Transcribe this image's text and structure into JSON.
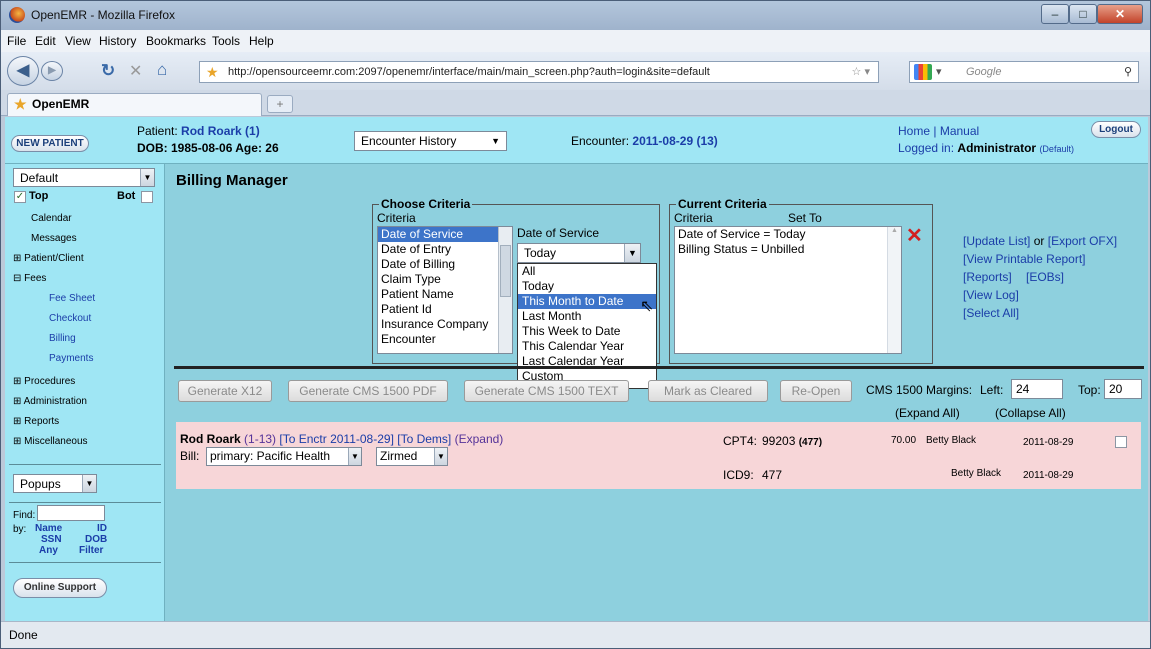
{
  "window": {
    "title": "OpenEMR - Mozilla Firefox",
    "min": "–",
    "max": "□",
    "close": "✕"
  },
  "menu": [
    "File",
    "Edit",
    "View",
    "History",
    "Bookmarks",
    "Tools",
    "Help"
  ],
  "nav": {
    "url": "http://opensourceemr.com:2097/openemr/interface/main/main_screen.php?auth=login&site=default",
    "search_placeholder": "Google"
  },
  "tab": {
    "label": "OpenEMR",
    "new_tab": "+"
  },
  "header": {
    "new_patient": "NEW PATIENT",
    "patient_label": "Patient:",
    "patient_name": "Rod Roark (1)",
    "dob": "DOB: 1985-08-06 Age: 26",
    "encounter_history": "Encounter History",
    "encounter_label": "Encounter:",
    "encounter_value": "2011-08-29 (13)",
    "home": "Home",
    "sep": "|",
    "manual": "Manual",
    "logged_in": "Logged in:",
    "admin": "Administrator",
    "role": "(Default)",
    "logout": "Logout"
  },
  "sidebar": {
    "layout": "Default",
    "top": "Top",
    "bot": "Bot",
    "items": [
      {
        "label": "Calendar",
        "kind": "link"
      },
      {
        "label": "Messages",
        "kind": "link"
      },
      {
        "label": "Patient/Client",
        "kind": "group"
      },
      {
        "label": "Fees",
        "kind": "group-open"
      },
      {
        "label": "Fee Sheet",
        "kind": "sub"
      },
      {
        "label": "Checkout",
        "kind": "sub"
      },
      {
        "label": "Billing",
        "kind": "sub"
      },
      {
        "label": "Payments",
        "kind": "sub"
      },
      {
        "label": "Procedures",
        "kind": "group"
      },
      {
        "label": "Administration",
        "kind": "group"
      },
      {
        "label": "Reports",
        "kind": "group"
      },
      {
        "label": "Miscellaneous",
        "kind": "group"
      }
    ],
    "popups": "Popups",
    "find": "Find:",
    "by": "by:",
    "name": "Name",
    "id": "ID",
    "ssn": "SSN",
    "dob": "DOB",
    "any": "Any",
    "filter": "Filter",
    "support": "Online Support"
  },
  "billing": {
    "title": "Billing Manager",
    "choose_legend": "Choose Criteria",
    "criteria_label": "Criteria",
    "criteria": [
      "Date of Service",
      "Date of Entry",
      "Date of Billing",
      "Claim Type",
      "Patient Name",
      "Patient Id",
      "Insurance Company",
      "Encounter"
    ],
    "dos_label": "Date of Service",
    "dos_value": "Today",
    "dos_options": [
      "All",
      "Today",
      "This Month to Date",
      "Last Month",
      "This Week to Date",
      "This Calendar Year",
      "Last Calendar Year",
      "Custom"
    ],
    "current_legend": "Current Criteria",
    "cur_criteria": "Criteria",
    "cur_setto": "Set To",
    "current": [
      "Date of Service = Today",
      "Billing Status = Unbilled"
    ],
    "links": [
      "[Update List]",
      "or",
      "[Export OFX]",
      "[View Printable Report]",
      "[Reports]",
      "[EOBs]",
      "[View Log]",
      "[Select All]"
    ],
    "buttons": [
      "Generate X12",
      "Generate CMS 1500 PDF",
      "Generate CMS 1500 TEXT",
      "Mark as Cleared",
      "Re-Open"
    ],
    "margins_label": "CMS 1500 Margins:",
    "left_label": "Left:",
    "left_val": "24",
    "top_label": "Top:",
    "top_val": "20",
    "expand_all": "(Expand All)",
    "collapse_all": "(Collapse All)"
  },
  "row": {
    "name": "Rod Roark",
    "ids": "(1-13)",
    "encounter": "[To Enctr 2011-08-29]",
    "dems": "[To Dems]",
    "expand": "(Expand)",
    "bill": "Bill:",
    "bill_value": "primary: Pacific Health",
    "partner": "Zirmed",
    "cpt_label": "CPT4:",
    "cpt_code": "99203",
    "cpt_extra": "(477)",
    "amount": "70.00",
    "provider": "Betty Black",
    "date": "2011-08-29",
    "icd_label": "ICD9:",
    "icd_code": "477",
    "provider2": "Betty Black",
    "date2": "2011-08-29"
  },
  "status": "Done"
}
